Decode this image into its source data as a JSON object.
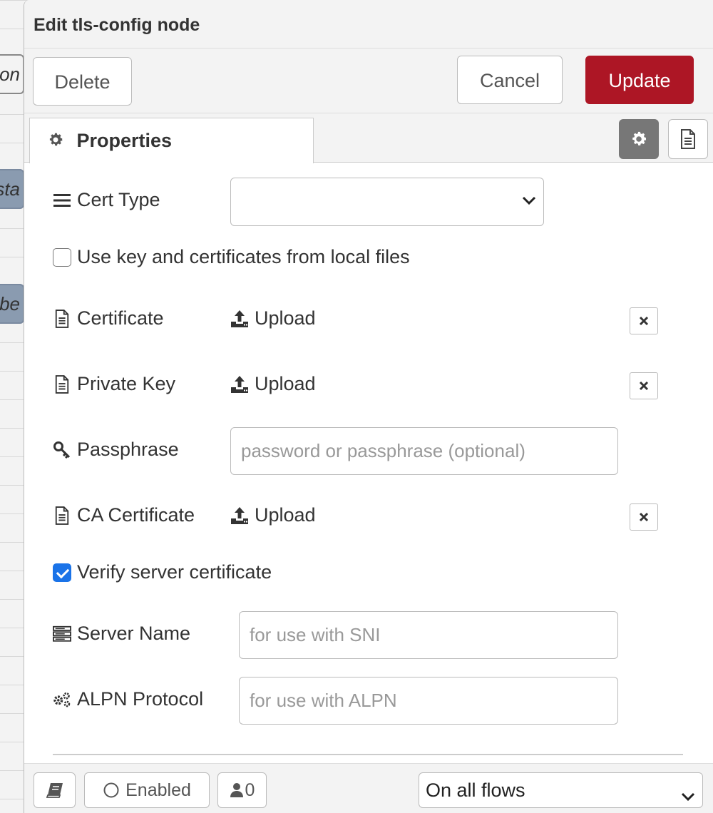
{
  "workspace": {
    "node_labels": [
      "tion",
      "sta",
      "mbe"
    ]
  },
  "dialog": {
    "title": "Edit tls-config node",
    "toolbar": {
      "delete_label": "Delete",
      "cancel_label": "Cancel",
      "update_label": "Update"
    },
    "tabs": {
      "properties_label": "Properties"
    },
    "form": {
      "cert_type": {
        "label": "Cert Type",
        "value": ""
      },
      "use_local_files": {
        "label": "Use key and certificates from local files",
        "checked": false
      },
      "certificate": {
        "label": "Certificate",
        "upload_label": "Upload"
      },
      "private_key": {
        "label": "Private Key",
        "upload_label": "Upload"
      },
      "passphrase": {
        "label": "Passphrase",
        "placeholder": "password or passphrase (optional)"
      },
      "ca_certificate": {
        "label": "CA Certificate",
        "upload_label": "Upload"
      },
      "verify_server": {
        "label": "Verify server certificate",
        "checked": true
      },
      "server_name": {
        "label": "Server Name",
        "placeholder": "for use with SNI"
      },
      "alpn_protocol": {
        "label": "ALPN Protocol",
        "placeholder": "for use with ALPN"
      }
    },
    "footer": {
      "enabled_label": "Enabled",
      "users_count": "0",
      "scope_value": "On all flows"
    },
    "colors": {
      "update_button": "#ad1625",
      "checkbox_checked": "#1a73e8",
      "active_icon_tab": "#777777"
    }
  }
}
